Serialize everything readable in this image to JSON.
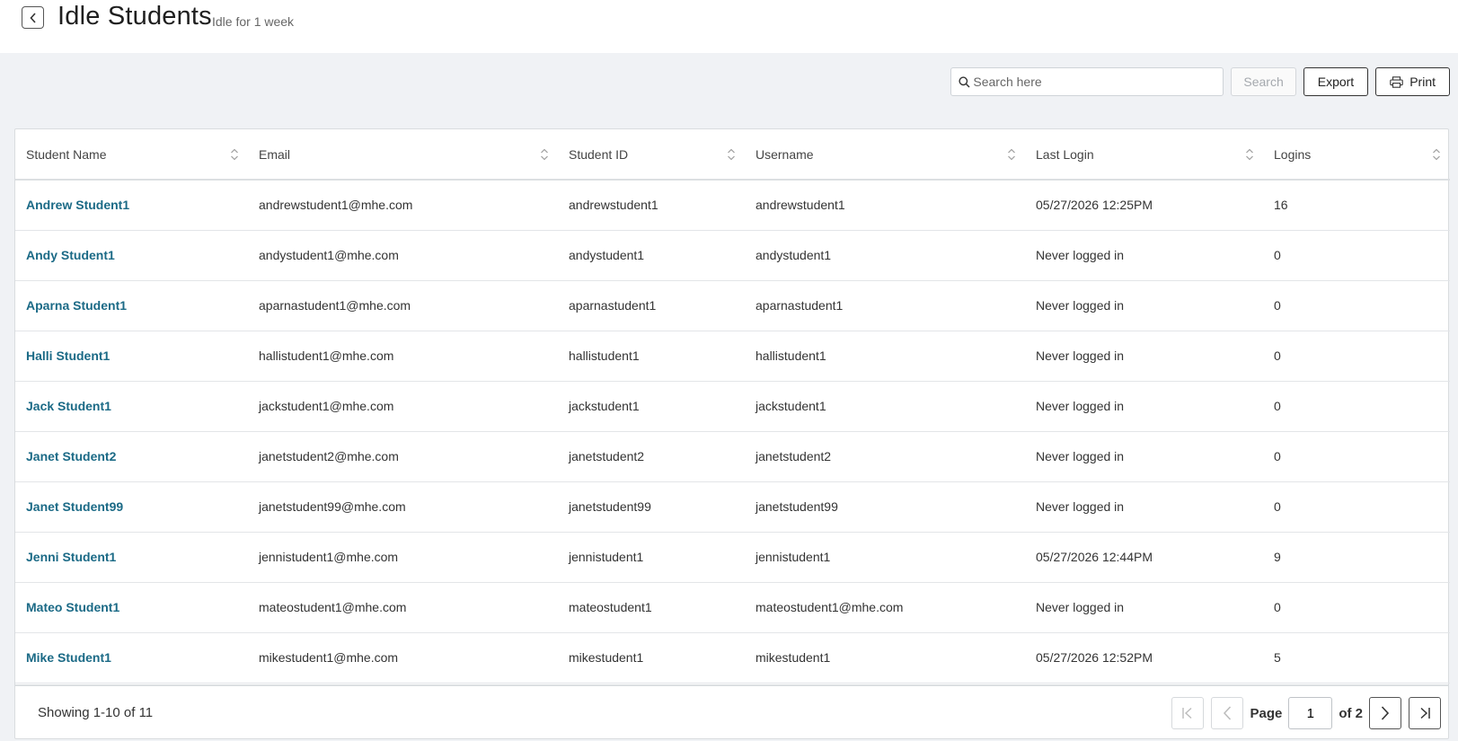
{
  "header": {
    "title": "Idle Students",
    "subtitle": "Idle for 1 week",
    "back_icon": "chevron-left-icon"
  },
  "toolbar": {
    "search_placeholder": "Search here",
    "search_value": "",
    "search_button": "Search",
    "export_button": "Export",
    "print_button": "Print"
  },
  "table": {
    "columns": [
      "Student Name",
      "Email",
      "Student ID",
      "Username",
      "Last Login",
      "Logins"
    ],
    "rows": [
      {
        "name": "Andrew Student1",
        "email": "andrewstudent1@mhe.com",
        "student_id": "andrewstudent1",
        "username": "andrewstudent1",
        "last_login": "05/27/2026 12:25PM",
        "logins": "16"
      },
      {
        "name": "Andy Student1",
        "email": "andystudent1@mhe.com",
        "student_id": "andystudent1",
        "username": "andystudent1",
        "last_login": "Never logged in",
        "logins": "0"
      },
      {
        "name": "Aparna Student1",
        "email": "aparnastudent1@mhe.com",
        "student_id": "aparnastudent1",
        "username": "aparnastudent1",
        "last_login": "Never logged in",
        "logins": "0"
      },
      {
        "name": "Halli Student1",
        "email": "hallistudent1@mhe.com",
        "student_id": "hallistudent1",
        "username": "hallistudent1",
        "last_login": "Never logged in",
        "logins": "0"
      },
      {
        "name": "Jack Student1",
        "email": "jackstudent1@mhe.com",
        "student_id": "jackstudent1",
        "username": "jackstudent1",
        "last_login": "Never logged in",
        "logins": "0"
      },
      {
        "name": "Janet Student2",
        "email": "janetstudent2@mhe.com",
        "student_id": "janetstudent2",
        "username": "janetstudent2",
        "last_login": "Never logged in",
        "logins": "0"
      },
      {
        "name": "Janet Student99",
        "email": "janetstudent99@mhe.com",
        "student_id": "janetstudent99",
        "username": "janetstudent99",
        "last_login": "Never logged in",
        "logins": "0"
      },
      {
        "name": "Jenni Student1",
        "email": "jennistudent1@mhe.com",
        "student_id": "jennistudent1",
        "username": "jennistudent1",
        "last_login": "05/27/2026 12:44PM",
        "logins": "9"
      },
      {
        "name": "Mateo Student1",
        "email": "mateostudent1@mhe.com",
        "student_id": "mateostudent1",
        "username": "mateostudent1@mhe.com",
        "last_login": "Never logged in",
        "logins": "0"
      },
      {
        "name": "Mike Student1",
        "email": "mikestudent1@mhe.com",
        "student_id": "mikestudent1",
        "username": "mikestudent1",
        "last_login": "05/27/2026 12:52PM",
        "logins": "5"
      }
    ]
  },
  "footer": {
    "showing": "Showing 1-10 of 11",
    "page_label": "Page",
    "page_value": "1",
    "of_label": "of 2"
  },
  "colors": {
    "link": "#1b6a86",
    "background": "#f0f2f5"
  }
}
